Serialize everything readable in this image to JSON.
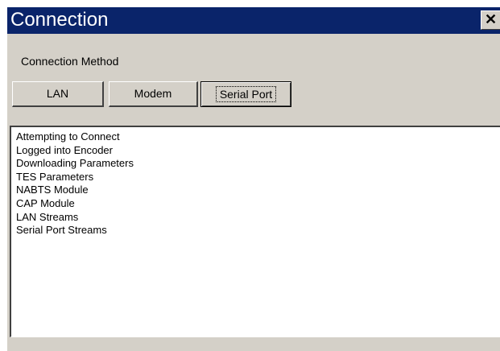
{
  "window": {
    "title": "Connection",
    "close_glyph": "✕",
    "close_icon": "close-icon"
  },
  "connection": {
    "group_label": "Connection Method",
    "buttons": [
      {
        "label": "LAN",
        "pressed": false
      },
      {
        "label": "Modem",
        "pressed": false
      },
      {
        "label": "Serial Port",
        "pressed": true
      }
    ]
  },
  "log": {
    "lines": [
      "Attempting to Connect",
      "Logged into Encoder",
      "Downloading Parameters",
      "TES Parameters",
      "NABTS Module",
      "CAP Module",
      "LAN Streams",
      "Serial Port Streams"
    ]
  },
  "colors": {
    "titlebar": "#0a246a",
    "face": "#d4d0c8",
    "title_text": "#ffffff"
  }
}
